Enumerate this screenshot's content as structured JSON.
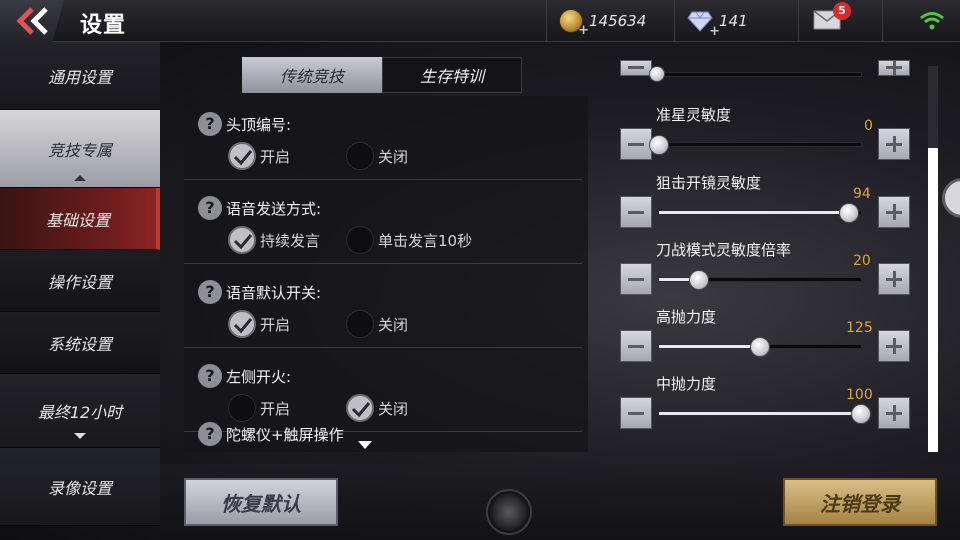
{
  "header": {
    "title": "设置",
    "coins": "145634",
    "diamonds": "141",
    "mail_badge": "5"
  },
  "sidebar": {
    "items": [
      {
        "label": "通用设置"
      },
      {
        "label": "竞技专属"
      },
      {
        "label": "基础设置"
      },
      {
        "label": "操作设置"
      },
      {
        "label": "系统设置"
      },
      {
        "label": "最终12小时"
      },
      {
        "label": "录像设置"
      }
    ]
  },
  "tabs": [
    "传统竞技",
    "生存特训"
  ],
  "options": [
    {
      "title": "头顶编号:",
      "choices": [
        "开启",
        "关闭"
      ],
      "selected": 0
    },
    {
      "title": "语音发送方式:",
      "choices": [
        "持续发言",
        "单击发言10秒"
      ],
      "selected": 0
    },
    {
      "title": "语音默认开关:",
      "choices": [
        "开启",
        "关闭"
      ],
      "selected": 0
    },
    {
      "title": "左侧开火:",
      "choices": [
        "开启",
        "关闭"
      ],
      "selected": 1
    },
    {
      "title": "陀螺仪+触屏操作",
      "choices": [],
      "selected": -1
    }
  ],
  "sliders": [
    {
      "label": "准星灵敏度",
      "value": "0",
      "fraction": 0.0
    },
    {
      "label": "狙击开镜灵敏度",
      "value": "94",
      "fraction": 0.94
    },
    {
      "label": "刀战模式灵敏度倍率",
      "value": "20",
      "fraction": 0.2
    },
    {
      "label": "高抛力度",
      "value": "125",
      "fraction": 0.5
    },
    {
      "label": "中抛力度",
      "value": "100",
      "fraction": 1.0
    }
  ],
  "top_partial_slider": {
    "fraction": 0.0
  },
  "footer": {
    "reset_label": "恢复默认",
    "logout_label": "注销登录"
  },
  "colors": {
    "accent_red": "#c0392b",
    "value_orange": "#e0a53a",
    "gold_button": "#c9a968",
    "wifi_green": "#5ac24b"
  }
}
